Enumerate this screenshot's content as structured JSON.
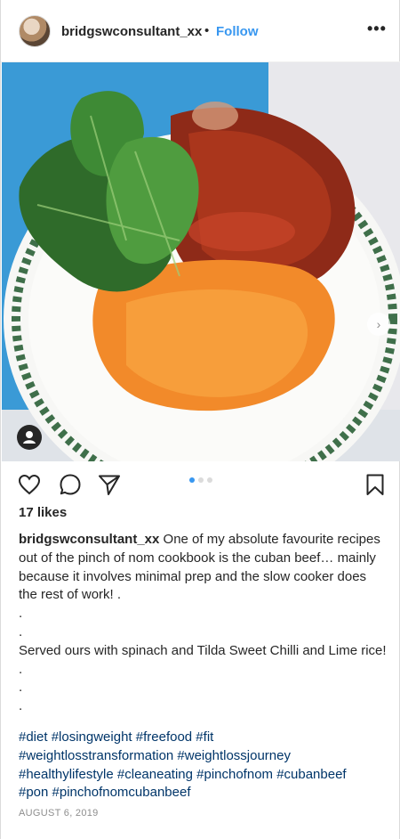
{
  "header": {
    "username": "bridgswconsultant_xx",
    "separator": "•",
    "follow_label": "Follow",
    "more_icon": "more-options-icon"
  },
  "media": {
    "description_icon": "photo-media",
    "next_icon": "chevron-right-icon",
    "tag_icon": "user-tag-icon"
  },
  "actions": {
    "like_icon": "heart-icon",
    "comment_icon": "comment-icon",
    "share_icon": "share-icon",
    "save_icon": "bookmark-icon",
    "carousel_count": 3,
    "carousel_active": 1
  },
  "likes": "17 likes",
  "caption": {
    "username": "bridgswconsultant_xx",
    "first": " One of my absolute favourite recipes out of the pinch of nom cookbook is the cuban beef… mainly because it involves minimal prep and the slow cooker does the rest of work! .",
    "dot1": ".",
    "dot2": ".",
    "second": "Served ours with spinach and Tilda Sweet Chilli and Lime rice! .",
    "dot3": ".",
    "dot4": "."
  },
  "hashtags": {
    "line1": "#diet #losingweight #freefood #fit",
    "line2": "#weightlosstransformation #weightlossjourney",
    "line3": "#healthylifestyle #cleaneating #pinchofnom #cubanbeef",
    "line4": "#pon #pinchofnomcubanbeef"
  },
  "date": "AUGUST 6, 2019",
  "colors": {
    "link_blue": "#3897f0",
    "hashtag_blue": "#003569",
    "text": "#262626",
    "muted": "#8e8e8e"
  }
}
